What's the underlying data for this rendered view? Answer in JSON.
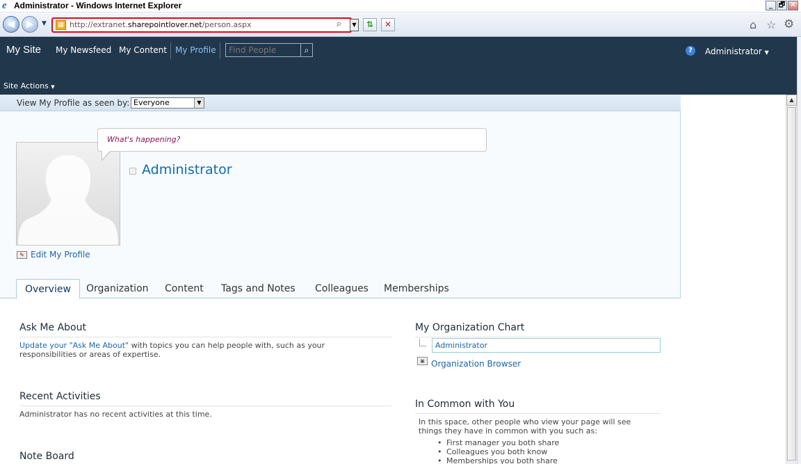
{
  "window": {
    "title": "Administrator - Windows Internet Explorer",
    "min_glyph": "_",
    "max_glyph": "🗗",
    "close_glyph": "✕"
  },
  "addressbar": {
    "url_prefix": "http://extranet.",
    "url_domain": "sharepointlover.net",
    "url_path": "/person.aspx"
  },
  "topnav": {
    "site_title": "My Site",
    "items": [
      "My Newsfeed",
      "My Content",
      "My Profile"
    ],
    "search_placeholder": "Find People",
    "user_menu": "Administrator",
    "site_actions": "Site Actions"
  },
  "viewbar": {
    "label": "View My Profile as seen by:",
    "selected": "Everyone"
  },
  "profile": {
    "status_placeholder": "What's happening?",
    "name": "Administrator",
    "edit_link": "Edit My Profile"
  },
  "tabs": [
    "Overview",
    "Organization",
    "Content",
    "Tags and Notes",
    "Colleagues",
    "Memberships"
  ],
  "active_tab": "Overview",
  "left": {
    "ask_me_about": {
      "title": "Ask Me About",
      "link_text": "Update your \"Ask Me About\"",
      "text_1": " with topics you can help people with, such as your",
      "text_2": "responsibilities or areas of expertise."
    },
    "recent_activities": {
      "title": "Recent Activities",
      "text": "Administrator has no recent activities at this time."
    },
    "note_board": {
      "title": "Note Board"
    }
  },
  "right": {
    "org_chart": {
      "title": "My Organization Chart",
      "node": "Administrator",
      "browser_link": "Organization Browser"
    },
    "in_common": {
      "title": "In Common with You",
      "text_1": "In this space, other people who view your page will see",
      "text_2": "things they have in common with you such as:",
      "items": [
        "First manager you both share",
        "Colleagues you both know",
        "Memberships you both share"
      ]
    }
  },
  "colors": {
    "header_bg": "#21374c",
    "link": "#1d64a8",
    "name": "#0f6aae",
    "highlight_border": "#d80d1c"
  }
}
